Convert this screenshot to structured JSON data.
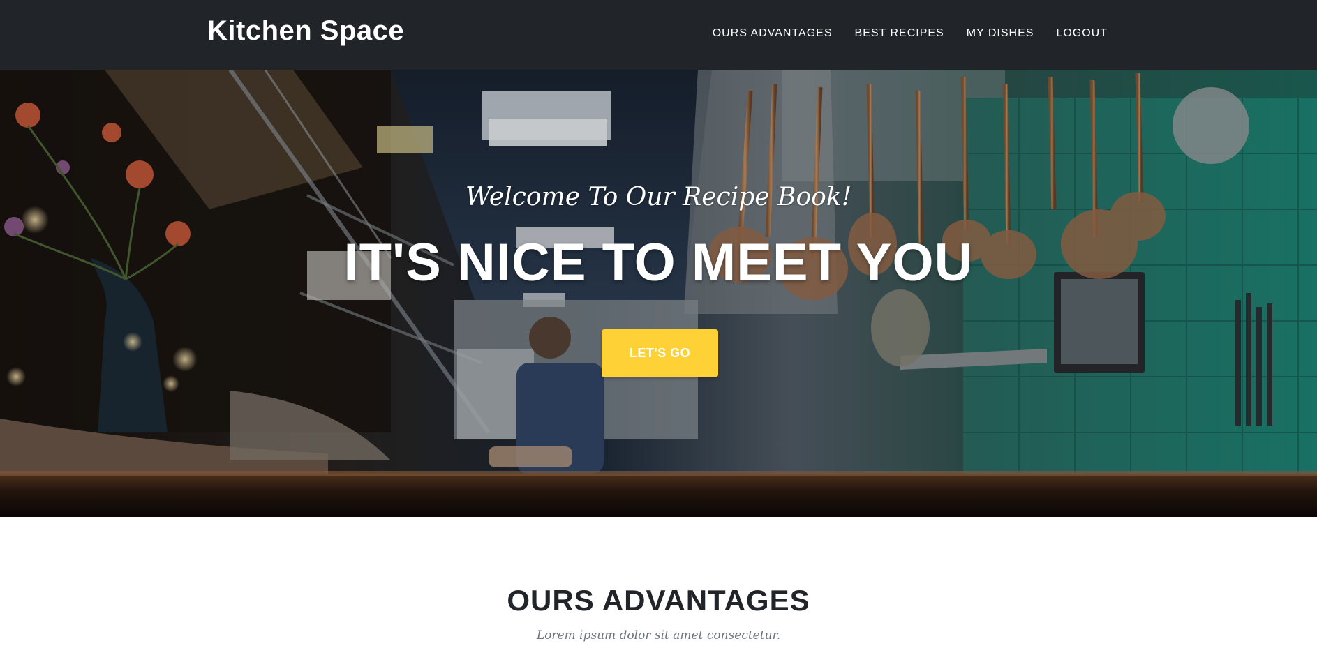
{
  "navbar": {
    "brand": "Kitchen Space",
    "links": [
      {
        "label": "OURS ADVANTAGES"
      },
      {
        "label": "BEST RECIPES"
      },
      {
        "label": "MY DISHES"
      },
      {
        "label": "LOGOUT"
      }
    ],
    "background_color": "#212529"
  },
  "hero": {
    "subtitle": "Welcome To Our Recipe Book!",
    "title": "IT'S NICE TO MEET YOU",
    "button_label": "LET'S GO",
    "button_color": "#fed136",
    "background_image": "kitchen-photo"
  },
  "advantages": {
    "title": "OURS ADVANTAGES",
    "subtitle": "Lorem ipsum dolor sit amet consectetur."
  }
}
